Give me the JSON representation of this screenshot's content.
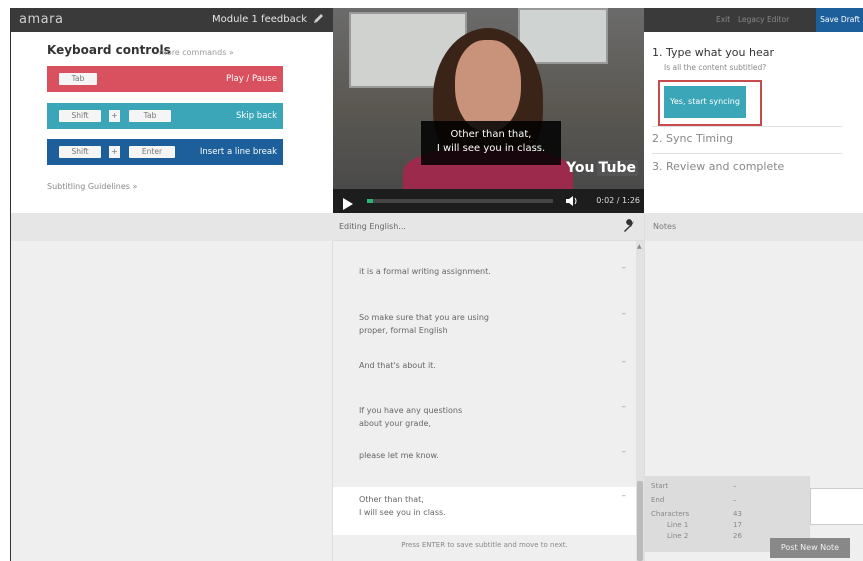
{
  "header": {
    "logo": "amara",
    "title": "Module 1 feedback"
  },
  "keyboard": {
    "title": "Keyboard controls",
    "more": "more commands »",
    "play": {
      "key": "Tab",
      "label": "Play / Pause",
      "color": "#d9505e"
    },
    "skip": {
      "key1": "Shift",
      "plus": "+",
      "key2": "Tab",
      "label": "Skip back",
      "color": "#3aa6b8"
    },
    "linebreak": {
      "key1": "Shift",
      "plus": "+",
      "key2": "Enter",
      "label": "Insert a line break",
      "color": "#1d5f9b"
    },
    "guidelines": "Subtitling Guidelines »"
  },
  "video": {
    "caption_line1": "Other than that,",
    "caption_line2": "I will see you in class.",
    "yt_you": "You",
    "yt_tube": "Tube",
    "progress": 0.03,
    "timecode": "0:02 / 1:26"
  },
  "toolbar": {
    "exit": "Exit",
    "legacy": "Legacy Editor",
    "save_draft": "Save Draft"
  },
  "steps": {
    "step1": "1.  Type what you hear",
    "step1_sub": "Is all the content subtitled?",
    "sync_button": "Yes, start syncing",
    "step2": "2.  Sync Timing",
    "step3": "3.  Review and complete"
  },
  "editor": {
    "heading": "Editing English...",
    "subtitles": [
      {
        "line1": "it is a formal writing assignment.",
        "line2": ""
      },
      {
        "line1": "So make sure that you are using",
        "line2": "proper, formal English"
      },
      {
        "line1": "And that's about it.",
        "line2": ""
      },
      {
        "line1": "If you have any questions",
        "line2": "about your grade,"
      },
      {
        "line1": "please let me know.",
        "line2": ""
      },
      {
        "line1": "Other than that,",
        "line2": "I will see you in class."
      }
    ],
    "dash": "–",
    "hint": "Press ENTER to save subtitle and move to next."
  },
  "notes": {
    "heading": "Notes",
    "stats": {
      "start_label": "Start",
      "start_val": "–",
      "end_label": "End",
      "end_val": "–",
      "chars_label": "Characters",
      "chars_val": "43",
      "line1_label": "Line 1",
      "line1_val": "17",
      "line2_label": "Line 2",
      "line2_val": "26"
    },
    "post_button": "Post New Note"
  }
}
